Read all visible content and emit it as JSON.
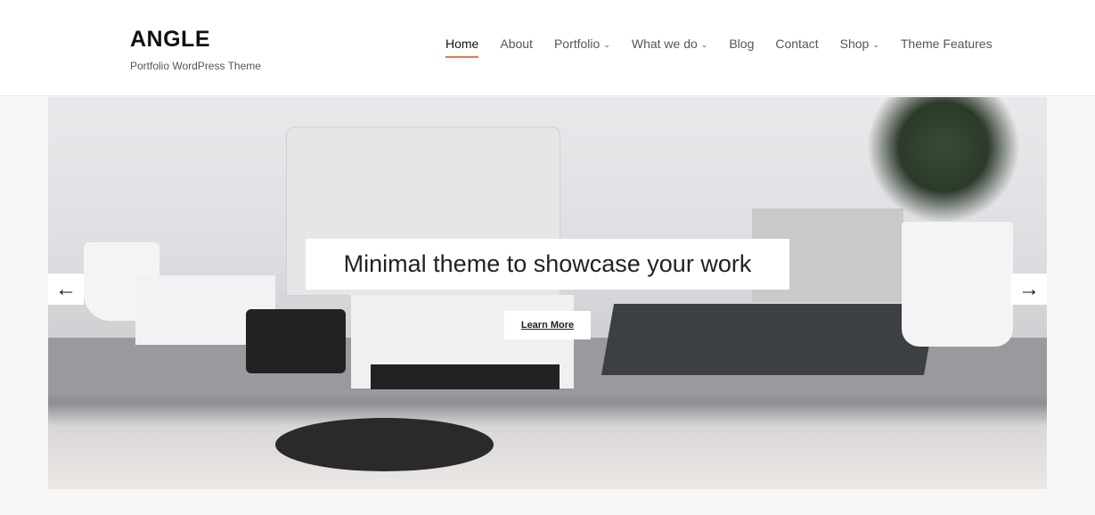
{
  "site": {
    "title": "ANGLE",
    "tagline": "Portfolio WordPress Theme"
  },
  "nav": {
    "items": [
      {
        "label": "Home",
        "active": true,
        "dropdown": false
      },
      {
        "label": "About",
        "dropdown": false
      },
      {
        "label": "Portfolio",
        "dropdown": true
      },
      {
        "label": "What we do",
        "dropdown": true
      },
      {
        "label": "Blog",
        "dropdown": false
      },
      {
        "label": "Contact",
        "dropdown": false
      },
      {
        "label": "Shop",
        "dropdown": true
      },
      {
        "label": "Theme Features",
        "dropdown": false
      }
    ],
    "accent": "#e07b4a"
  },
  "slider": {
    "caption": "Minimal theme to showcase your work",
    "button_label": "Learn More",
    "prev_icon": "arrow-left-icon",
    "next_icon": "arrow-right-icon"
  }
}
